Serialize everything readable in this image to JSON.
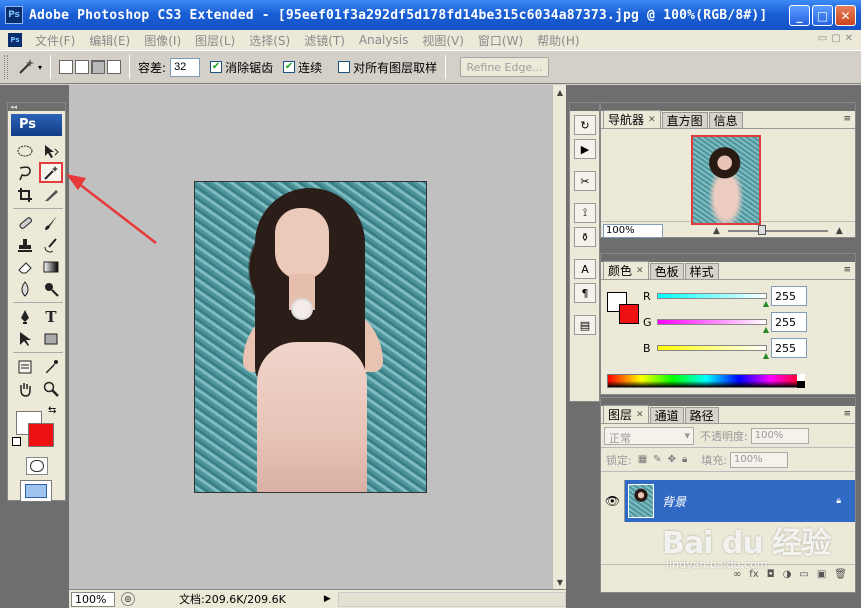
{
  "window": {
    "title": "Adobe Photoshop CS3 Extended - [95eef01f3a292df5d178fd14be315c6034a87373.jpg @ 100%(RGB/8#)]",
    "logo": "Ps",
    "buttons": {
      "minimize": "_",
      "maximize": "□",
      "close": "✕"
    }
  },
  "menu": {
    "logo": "Ps",
    "items": [
      "文件(F)",
      "编辑(E)",
      "图像(I)",
      "图层(L)",
      "选择(S)",
      "滤镜(T)",
      "Analysis",
      "视图(V)",
      "窗口(W)",
      "帮助(H)"
    ],
    "doc_controls": [
      "▭",
      "▢",
      "✕"
    ]
  },
  "options": {
    "tolerance_label": "容差:",
    "tolerance_value": "32",
    "antialias_label": "消除锯齿",
    "antialias_checked": true,
    "contiguous_label": "连续",
    "contiguous_checked": true,
    "sample_all_label": "对所有图层取样",
    "sample_all_checked": false,
    "refine_edge_label": "Refine Edge..."
  },
  "toolbox": {
    "badge": "Ps",
    "selected_tool": "magic-wand",
    "colors": {
      "foreground": "#ffffff",
      "background": "#ee1111"
    }
  },
  "status": {
    "zoom": "100%",
    "doc_info": "文档:209.6K/209.6K"
  },
  "navigator_panel": {
    "tabs": [
      "导航器",
      "直方图",
      "信息"
    ],
    "zoom": "100%"
  },
  "color_panel": {
    "tabs": [
      "颜色",
      "色板",
      "样式"
    ],
    "channels": [
      {
        "name": "R",
        "value": "255"
      },
      {
        "name": "G",
        "value": "255"
      },
      {
        "name": "B",
        "value": "255"
      }
    ]
  },
  "layers_panel": {
    "tabs": [
      "图层",
      "通道",
      "路径"
    ],
    "blend_mode": "正常",
    "opacity_label": "不透明度:",
    "opacity_value": "100%",
    "lock_label": "锁定:",
    "fill_label": "填充:",
    "fill_value": "100%",
    "layers": [
      {
        "name": "背景",
        "visible": true,
        "locked": true
      }
    ]
  },
  "watermark": {
    "brand": "Bai du 经验",
    "url": "jingyan.baidu.com"
  }
}
